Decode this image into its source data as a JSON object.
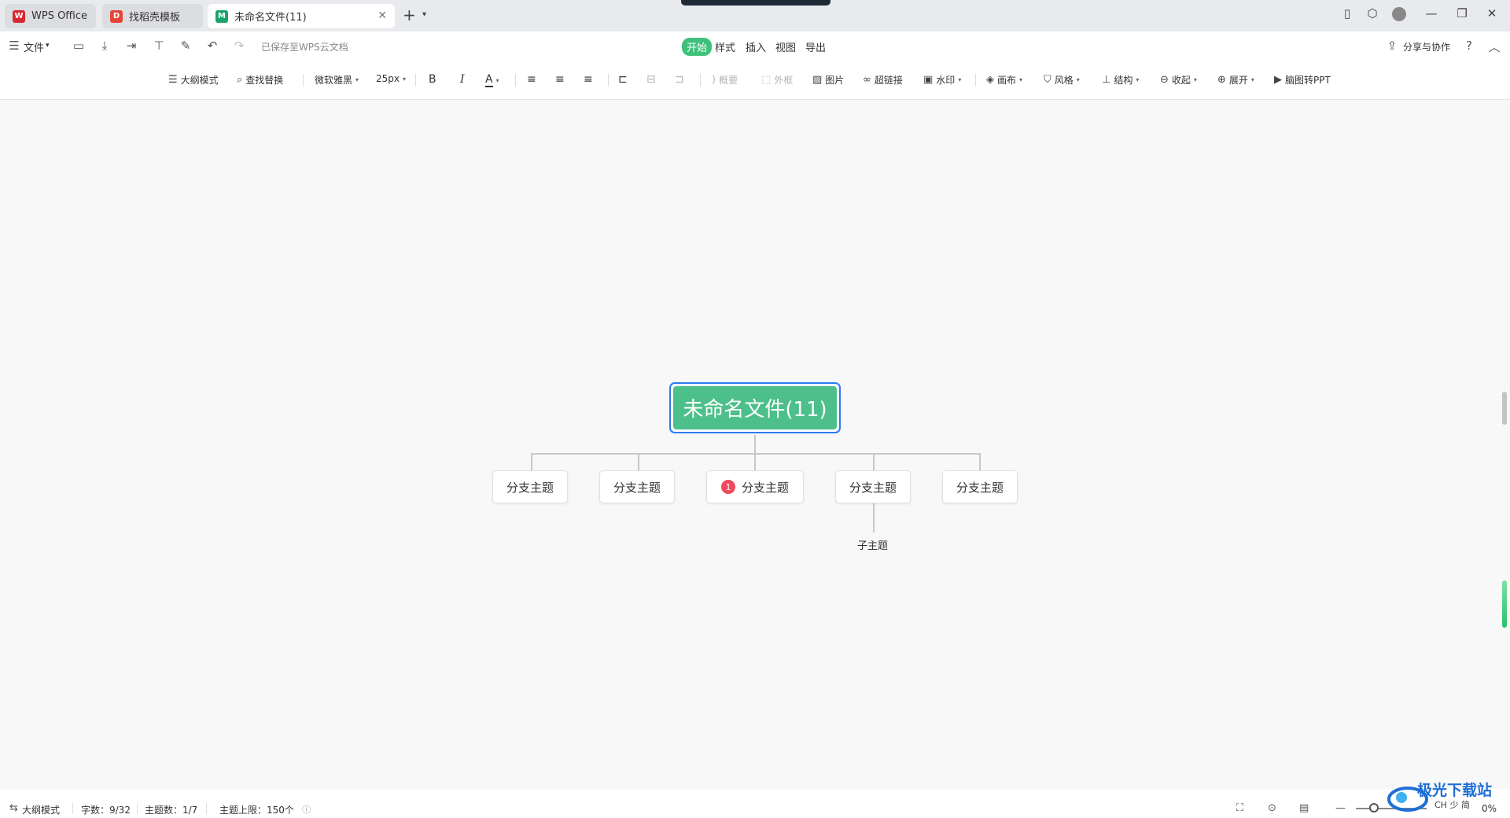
{
  "tabs": [
    {
      "label": "WPS Office",
      "icon": "wps-logo-icon",
      "color": "#d7282f"
    },
    {
      "label": "找稻壳模板",
      "icon": "docer-icon",
      "color": "#e6453a"
    },
    {
      "label": "未命名文件(11)",
      "icon": "mindmap-file-icon",
      "color": "#1ba36b"
    }
  ],
  "menu": {
    "file_label": "文件",
    "saved_status": "已保存至WPS云文档",
    "tabs": [
      "开始",
      "样式",
      "插入",
      "视图",
      "导出"
    ],
    "active_tab": "开始",
    "share_label": "分享与协作"
  },
  "toolbar": {
    "outline_mode": "大纲模式",
    "find_replace": "查找替换",
    "font_family": "微软雅黑",
    "font_size": "25px",
    "bold": "B",
    "italic": "I",
    "font_color": "A",
    "summary": "概要",
    "frame": "外框",
    "image": "图片",
    "hyperlink": "超链接",
    "watermark": "水印",
    "canvas": "画布",
    "style": "风格",
    "structure": "结构",
    "collapse": "收起",
    "expand": "展开",
    "to_ppt": "脑图转PPT"
  },
  "mindmap": {
    "root": "未命名文件(11)",
    "branches": [
      {
        "label": "分支主题"
      },
      {
        "label": "分支主题"
      },
      {
        "label": "分支主题",
        "badge": "1"
      },
      {
        "label": "分支主题"
      },
      {
        "label": "分支主题"
      }
    ],
    "subtopic": "子主题",
    "root_color": "#4dbf8a",
    "selected_border": "#2b7cf0"
  },
  "status": {
    "outline_mode": "大纲模式",
    "word_count": "字数：9/32",
    "topic_count": "主题数：1/7",
    "topic_limit": "主题上限：150个",
    "zoom": "0%"
  },
  "watermark": {
    "text": "极光下载站",
    "site": "CH 少 简"
  }
}
